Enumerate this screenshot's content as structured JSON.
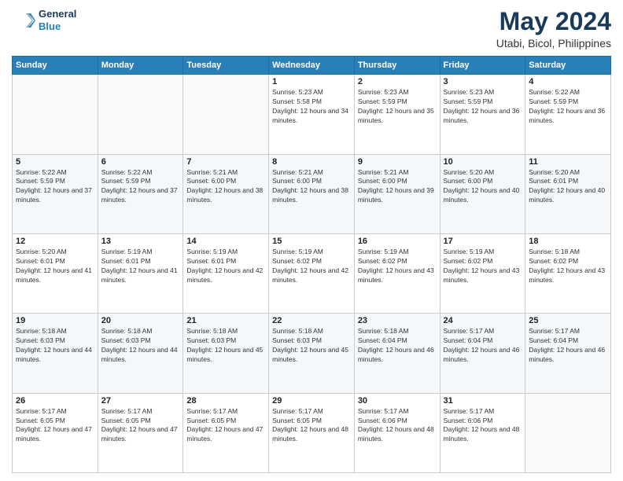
{
  "header": {
    "logo_line1": "General",
    "logo_line2": "Blue",
    "month": "May 2024",
    "location": "Utabi, Bicol, Philippines"
  },
  "weekdays": [
    "Sunday",
    "Monday",
    "Tuesday",
    "Wednesday",
    "Thursday",
    "Friday",
    "Saturday"
  ],
  "weeks": [
    [
      {
        "day": "",
        "sunrise": "",
        "sunset": "",
        "daylight": "",
        "empty": true
      },
      {
        "day": "",
        "sunrise": "",
        "sunset": "",
        "daylight": "",
        "empty": true
      },
      {
        "day": "",
        "sunrise": "",
        "sunset": "",
        "daylight": "",
        "empty": true
      },
      {
        "day": "1",
        "sunrise": "Sunrise: 5:23 AM",
        "sunset": "Sunset: 5:58 PM",
        "daylight": "Daylight: 12 hours and 34 minutes.",
        "empty": false
      },
      {
        "day": "2",
        "sunrise": "Sunrise: 5:23 AM",
        "sunset": "Sunset: 5:59 PM",
        "daylight": "Daylight: 12 hours and 35 minutes.",
        "empty": false
      },
      {
        "day": "3",
        "sunrise": "Sunrise: 5:23 AM",
        "sunset": "Sunset: 5:59 PM",
        "daylight": "Daylight: 12 hours and 36 minutes.",
        "empty": false
      },
      {
        "day": "4",
        "sunrise": "Sunrise: 5:22 AM",
        "sunset": "Sunset: 5:59 PM",
        "daylight": "Daylight: 12 hours and 36 minutes.",
        "empty": false
      }
    ],
    [
      {
        "day": "5",
        "sunrise": "Sunrise: 5:22 AM",
        "sunset": "Sunset: 5:59 PM",
        "daylight": "Daylight: 12 hours and 37 minutes.",
        "empty": false
      },
      {
        "day": "6",
        "sunrise": "Sunrise: 5:22 AM",
        "sunset": "Sunset: 5:59 PM",
        "daylight": "Daylight: 12 hours and 37 minutes.",
        "empty": false
      },
      {
        "day": "7",
        "sunrise": "Sunrise: 5:21 AM",
        "sunset": "Sunset: 6:00 PM",
        "daylight": "Daylight: 12 hours and 38 minutes.",
        "empty": false
      },
      {
        "day": "8",
        "sunrise": "Sunrise: 5:21 AM",
        "sunset": "Sunset: 6:00 PM",
        "daylight": "Daylight: 12 hours and 38 minutes.",
        "empty": false
      },
      {
        "day": "9",
        "sunrise": "Sunrise: 5:21 AM",
        "sunset": "Sunset: 6:00 PM",
        "daylight": "Daylight: 12 hours and 39 minutes.",
        "empty": false
      },
      {
        "day": "10",
        "sunrise": "Sunrise: 5:20 AM",
        "sunset": "Sunset: 6:00 PM",
        "daylight": "Daylight: 12 hours and 40 minutes.",
        "empty": false
      },
      {
        "day": "11",
        "sunrise": "Sunrise: 5:20 AM",
        "sunset": "Sunset: 6:01 PM",
        "daylight": "Daylight: 12 hours and 40 minutes.",
        "empty": false
      }
    ],
    [
      {
        "day": "12",
        "sunrise": "Sunrise: 5:20 AM",
        "sunset": "Sunset: 6:01 PM",
        "daylight": "Daylight: 12 hours and 41 minutes.",
        "empty": false
      },
      {
        "day": "13",
        "sunrise": "Sunrise: 5:19 AM",
        "sunset": "Sunset: 6:01 PM",
        "daylight": "Daylight: 12 hours and 41 minutes.",
        "empty": false
      },
      {
        "day": "14",
        "sunrise": "Sunrise: 5:19 AM",
        "sunset": "Sunset: 6:01 PM",
        "daylight": "Daylight: 12 hours and 42 minutes.",
        "empty": false
      },
      {
        "day": "15",
        "sunrise": "Sunrise: 5:19 AM",
        "sunset": "Sunset: 6:02 PM",
        "daylight": "Daylight: 12 hours and 42 minutes.",
        "empty": false
      },
      {
        "day": "16",
        "sunrise": "Sunrise: 5:19 AM",
        "sunset": "Sunset: 6:02 PM",
        "daylight": "Daylight: 12 hours and 43 minutes.",
        "empty": false
      },
      {
        "day": "17",
        "sunrise": "Sunrise: 5:19 AM",
        "sunset": "Sunset: 6:02 PM",
        "daylight": "Daylight: 12 hours and 43 minutes.",
        "empty": false
      },
      {
        "day": "18",
        "sunrise": "Sunrise: 5:18 AM",
        "sunset": "Sunset: 6:02 PM",
        "daylight": "Daylight: 12 hours and 43 minutes.",
        "empty": false
      }
    ],
    [
      {
        "day": "19",
        "sunrise": "Sunrise: 5:18 AM",
        "sunset": "Sunset: 6:03 PM",
        "daylight": "Daylight: 12 hours and 44 minutes.",
        "empty": false
      },
      {
        "day": "20",
        "sunrise": "Sunrise: 5:18 AM",
        "sunset": "Sunset: 6:03 PM",
        "daylight": "Daylight: 12 hours and 44 minutes.",
        "empty": false
      },
      {
        "day": "21",
        "sunrise": "Sunrise: 5:18 AM",
        "sunset": "Sunset: 6:03 PM",
        "daylight": "Daylight: 12 hours and 45 minutes.",
        "empty": false
      },
      {
        "day": "22",
        "sunrise": "Sunrise: 5:18 AM",
        "sunset": "Sunset: 6:03 PM",
        "daylight": "Daylight: 12 hours and 45 minutes.",
        "empty": false
      },
      {
        "day": "23",
        "sunrise": "Sunrise: 5:18 AM",
        "sunset": "Sunset: 6:04 PM",
        "daylight": "Daylight: 12 hours and 46 minutes.",
        "empty": false
      },
      {
        "day": "24",
        "sunrise": "Sunrise: 5:17 AM",
        "sunset": "Sunset: 6:04 PM",
        "daylight": "Daylight: 12 hours and 46 minutes.",
        "empty": false
      },
      {
        "day": "25",
        "sunrise": "Sunrise: 5:17 AM",
        "sunset": "Sunset: 6:04 PM",
        "daylight": "Daylight: 12 hours and 46 minutes.",
        "empty": false
      }
    ],
    [
      {
        "day": "26",
        "sunrise": "Sunrise: 5:17 AM",
        "sunset": "Sunset: 6:05 PM",
        "daylight": "Daylight: 12 hours and 47 minutes.",
        "empty": false
      },
      {
        "day": "27",
        "sunrise": "Sunrise: 5:17 AM",
        "sunset": "Sunset: 6:05 PM",
        "daylight": "Daylight: 12 hours and 47 minutes.",
        "empty": false
      },
      {
        "day": "28",
        "sunrise": "Sunrise: 5:17 AM",
        "sunset": "Sunset: 6:05 PM",
        "daylight": "Daylight: 12 hours and 47 minutes.",
        "empty": false
      },
      {
        "day": "29",
        "sunrise": "Sunrise: 5:17 AM",
        "sunset": "Sunset: 6:05 PM",
        "daylight": "Daylight: 12 hours and 48 minutes.",
        "empty": false
      },
      {
        "day": "30",
        "sunrise": "Sunrise: 5:17 AM",
        "sunset": "Sunset: 6:06 PM",
        "daylight": "Daylight: 12 hours and 48 minutes.",
        "empty": false
      },
      {
        "day": "31",
        "sunrise": "Sunrise: 5:17 AM",
        "sunset": "Sunset: 6:06 PM",
        "daylight": "Daylight: 12 hours and 48 minutes.",
        "empty": false
      },
      {
        "day": "",
        "sunrise": "",
        "sunset": "",
        "daylight": "",
        "empty": true
      }
    ]
  ]
}
